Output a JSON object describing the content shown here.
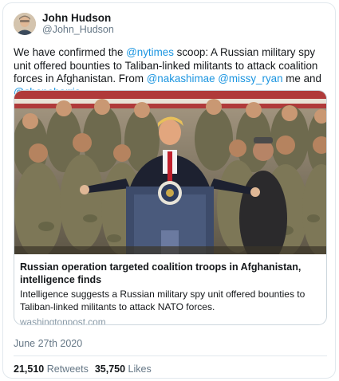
{
  "author": {
    "display_name": "John Hudson",
    "handle": "@John_Hudson"
  },
  "tweet": {
    "text_1": "We have confirmed the ",
    "mention_1": "@nytimes",
    "text_2": " scoop: A Russian military spy unit offered bounties to Taliban-linked militants to attack coalition forces in Afghanistan. From ",
    "mention_2": "@nakashimae",
    "text_3": " ",
    "mention_3": "@missy_ryan",
    "text_4": " me and ",
    "mention_4": "@shaneharris"
  },
  "link_card": {
    "title": "Russian operation targeted coalition troops in Afghanistan, intelligence finds",
    "description": "Intelligence suggests a Russian military spy unit offered bounties to Taliban-linked militants to attack NATO forces.",
    "domain": "washingtonpost.com"
  },
  "date": "June 27th 2020",
  "stats": {
    "retweets_count": "21,510",
    "retweets_label": "Retweets",
    "likes_count": "35,750",
    "likes_label": "Likes"
  },
  "colors": {
    "mention": "#1b95e0",
    "secondary_text": "#657786",
    "border": "#e1e8ed"
  }
}
